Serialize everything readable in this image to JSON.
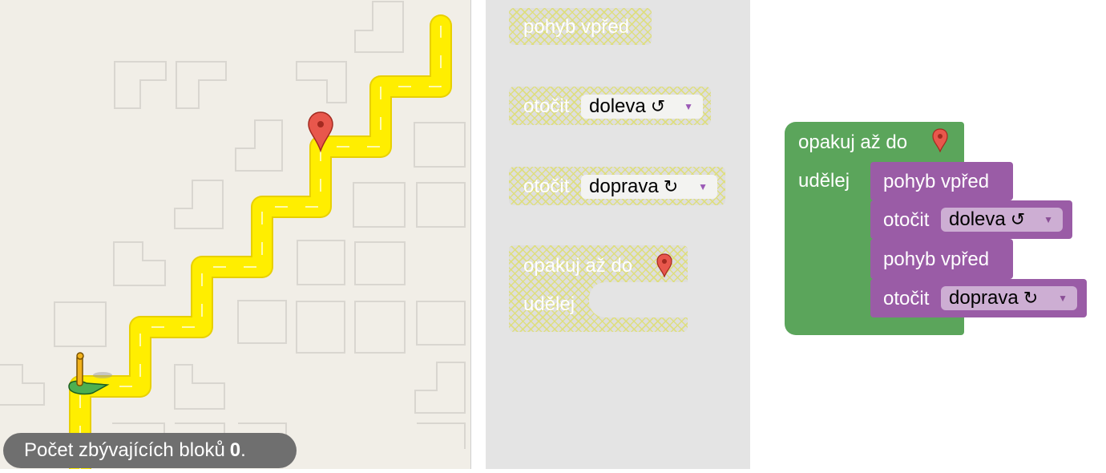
{
  "maze": {
    "remaining_blocks_text": "Počet zbývajících bloků",
    "remaining_blocks_count": "0",
    "remaining_blocks_suffix": "."
  },
  "toolbox": {
    "move_forward": "pohyb vpřed",
    "turn_left": {
      "label": "otočit",
      "value": "doleva",
      "icon": "↺"
    },
    "turn_right": {
      "label": "otočit",
      "value": "doprava",
      "icon": "↻"
    },
    "repeat_until": {
      "label": "opakuj až do",
      "do_label": "udělej"
    }
  },
  "workspace": {
    "repeat_until_label": "opakuj až do",
    "do_label": "udělej",
    "blocks": [
      {
        "type": "move",
        "label": "pohyb vpřed"
      },
      {
        "type": "turn",
        "label": "otočit",
        "value": "doleva",
        "icon": "↺"
      },
      {
        "type": "move",
        "label": "pohyb vpřed"
      },
      {
        "type": "turn",
        "label": "otočit",
        "value": "doprava",
        "icon": "↻"
      }
    ]
  },
  "colors": {
    "path": "#ffee00",
    "repeat_block": "#5ba55b",
    "action_block": "#9a5ca6",
    "marker": "#e8574c",
    "pegman_base": "#4caf50"
  },
  "icons": [
    "marker-icon",
    "pegman-icon",
    "turn-left-icon",
    "turn-right-icon",
    "dropdown-arrow-icon"
  ]
}
